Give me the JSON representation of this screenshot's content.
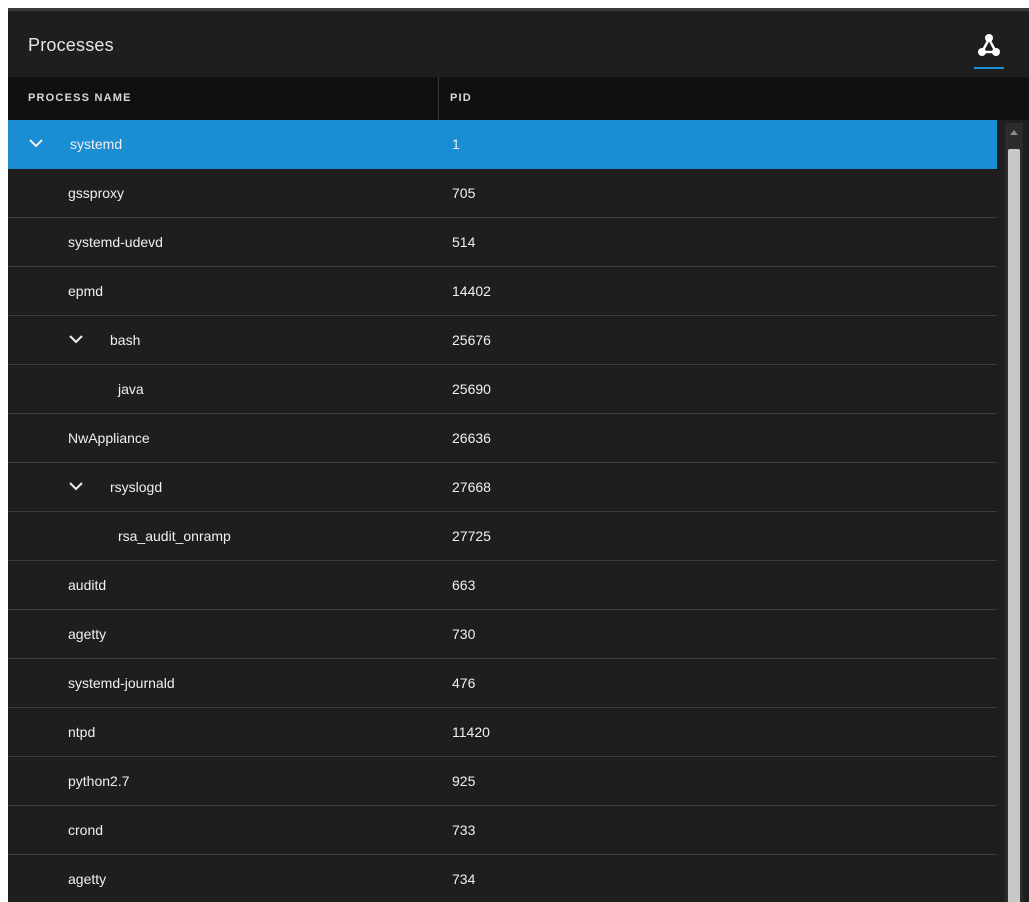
{
  "panel": {
    "title": "Processes",
    "view_icon": "process-tree-icon"
  },
  "table": {
    "columns": [
      "PROCESS NAME",
      "PID"
    ],
    "rows": [
      {
        "name": "systemd",
        "pid": "1",
        "level": 0,
        "expanded": true,
        "selected": true
      },
      {
        "name": "gssproxy",
        "pid": "705",
        "level": 1,
        "expanded": false,
        "selected": false
      },
      {
        "name": "systemd-udevd",
        "pid": "514",
        "level": 1,
        "expanded": false,
        "selected": false
      },
      {
        "name": "epmd",
        "pid": "14402",
        "level": 1,
        "expanded": false,
        "selected": false
      },
      {
        "name": "bash",
        "pid": "25676",
        "level": 1,
        "expanded": true,
        "selected": false
      },
      {
        "name": "java",
        "pid": "25690",
        "level": 2,
        "expanded": false,
        "selected": false
      },
      {
        "name": "NwAppliance",
        "pid": "26636",
        "level": 1,
        "expanded": false,
        "selected": false
      },
      {
        "name": "rsyslogd",
        "pid": "27668",
        "level": 1,
        "expanded": true,
        "selected": false
      },
      {
        "name": "rsa_audit_onramp",
        "pid": "27725",
        "level": 2,
        "expanded": false,
        "selected": false
      },
      {
        "name": "auditd",
        "pid": "663",
        "level": 1,
        "expanded": false,
        "selected": false
      },
      {
        "name": "agetty",
        "pid": "730",
        "level": 1,
        "expanded": false,
        "selected": false
      },
      {
        "name": "systemd-journald",
        "pid": "476",
        "level": 1,
        "expanded": false,
        "selected": false
      },
      {
        "name": "ntpd",
        "pid": "11420",
        "level": 1,
        "expanded": false,
        "selected": false
      },
      {
        "name": "python2.7",
        "pid": "925",
        "level": 1,
        "expanded": false,
        "selected": false
      },
      {
        "name": "crond",
        "pid": "733",
        "level": 1,
        "expanded": false,
        "selected": false
      },
      {
        "name": "agetty",
        "pid": "734",
        "level": 1,
        "expanded": false,
        "selected": false
      }
    ]
  },
  "colors": {
    "selected_row": "#1b8ed3",
    "accent": "#1e8fd6",
    "background": "#1e1e1e",
    "header_background": "#101010"
  }
}
